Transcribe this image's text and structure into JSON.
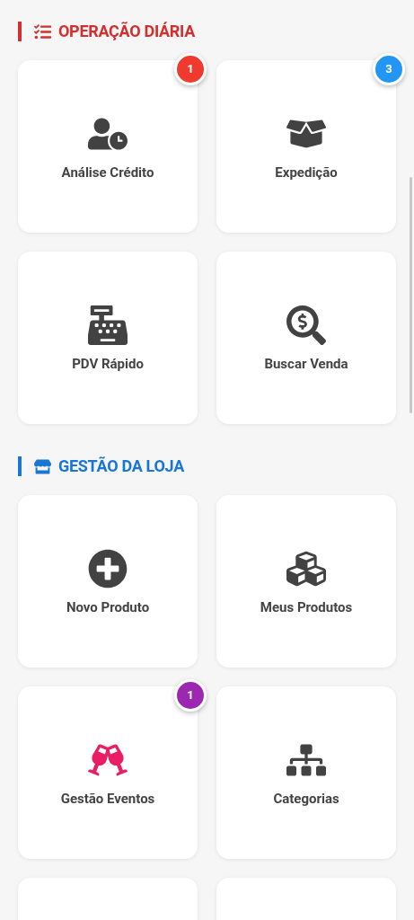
{
  "sections": [
    {
      "title": "OPERAÇÃO DIÁRIA",
      "color": "#d32f2f",
      "items": [
        {
          "label": "Análise Crédito",
          "color": "#424242",
          "badge": {
            "text": "1",
            "color": "#f03a2e"
          }
        },
        {
          "label": "Expedição",
          "color": "#424242",
          "badge": {
            "text": "3",
            "color": "#2196f3"
          }
        },
        {
          "label": "PDV Rápido",
          "color": "#424242"
        },
        {
          "label": "Buscar Venda",
          "color": "#424242"
        }
      ]
    },
    {
      "title": "GESTÃO DA LOJA",
      "color": "#1976d2",
      "items": [
        {
          "label": "Novo Produto",
          "color": "#424242"
        },
        {
          "label": "Meus Produtos",
          "color": "#424242"
        },
        {
          "label": "Gestão Eventos",
          "color": "#e91e63",
          "badge": {
            "text": "1",
            "color": "#9c27b0"
          }
        },
        {
          "label": "Categorias",
          "color": "#424242"
        }
      ]
    }
  ]
}
